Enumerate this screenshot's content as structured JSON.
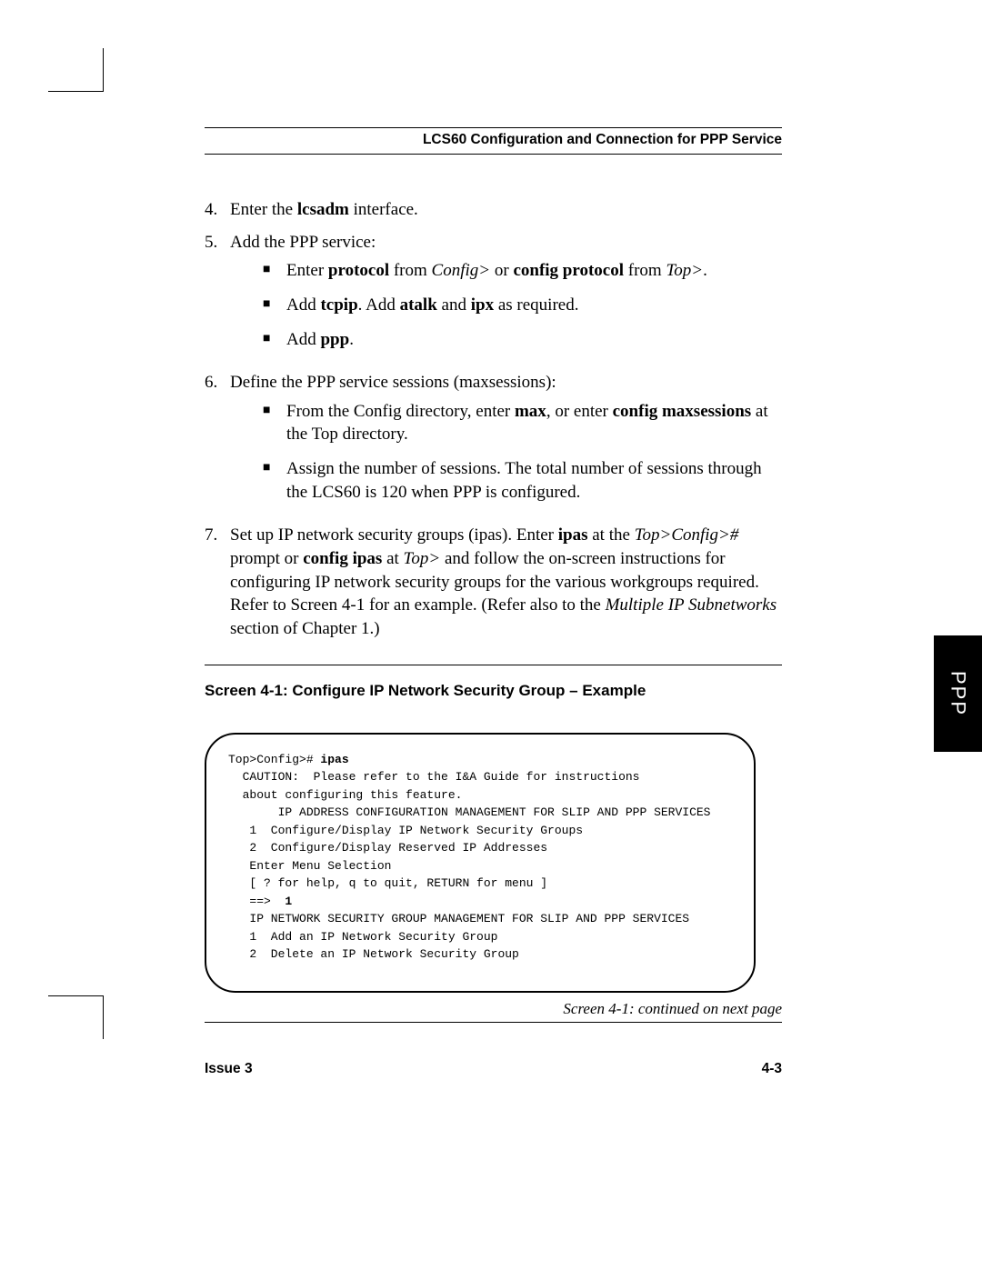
{
  "header": "LCS60 Configuration and Connection for PPP Service",
  "list": {
    "i4": {
      "num": "4.",
      "text_a": "Enter the ",
      "bold_a": "lcsadm",
      "text_b": " interface."
    },
    "i5": {
      "num": "5.",
      "text": "Add the PPP service:",
      "b1": {
        "a": "Enter ",
        "b": "protocol",
        "c": " from ",
        "d": "Config>",
        "e": " or ",
        "f": "config protocol",
        "g": " from ",
        "h": "Top>",
        "i": "."
      },
      "b2": {
        "a": "Add ",
        "b": "tcpip",
        "c": ".  Add ",
        "d": "atalk",
        "e": " and ",
        "f": "ipx",
        "g": " as required."
      },
      "b3": {
        "a": "Add ",
        "b": "ppp",
        "c": "."
      }
    },
    "i6": {
      "num": "6.",
      "text": "Define the PPP service sessions (maxsessions):",
      "b1": {
        "a": "From the Config directory, enter ",
        "b": "max",
        "c": ", or enter ",
        "d": "config maxsessions",
        "e": " at the Top directory."
      },
      "b2": {
        "a": "Assign the number of sessions.  The total number of sessions through the LCS60 is 120 when PPP is configured."
      }
    },
    "i7": {
      "num": "7.",
      "a": "Set up IP network security groups (ipas).  Enter ",
      "b": "ipas",
      "c": " at the ",
      "d": "Top>Config>#",
      "e": " prompt or ",
      "f": "config ipas",
      "g": " at ",
      "h": "Top>",
      "i": " and follow the on-screen instructions for configuring IP network security groups for the various workgroups required.   Refer to Screen 4-1 for an example.  (Refer also to the ",
      "j": "Multiple IP Subnetworks",
      "k": " section of Chapter 1.)"
    }
  },
  "screen_title": "Screen 4-1:  Configure IP Network Security Group – Example",
  "terminal": {
    "l1a": "Top>Config># ",
    "l1b": "ipas",
    "l2": "  CAUTION:  Please refer to the I&A Guide for instructions",
    "l3": "  about configuring this feature.",
    "l4": "       IP ADDRESS CONFIGURATION MANAGEMENT FOR SLIP AND PPP SERVICES",
    "l5": "   1  Configure/Display IP Network Security Groups",
    "l6": "   2  Configure/Display Reserved IP Addresses",
    "l7": "   Enter Menu Selection",
    "l8": "   [ ? for help, q to quit, RETURN for menu ]",
    "l9a": "   ==>  ",
    "l9b": "1",
    "l10": "   IP NETWORK SECURITY GROUP MANAGEMENT FOR SLIP AND PPP SERVICES",
    "l11": "   1  Add an IP Network Security Group",
    "l12": "   2  Delete an IP Network Security Group"
  },
  "continued": "Screen 4-1: continued on next page",
  "footer": {
    "left": "Issue 3",
    "right": "4-3"
  },
  "sidetab": "PPP"
}
